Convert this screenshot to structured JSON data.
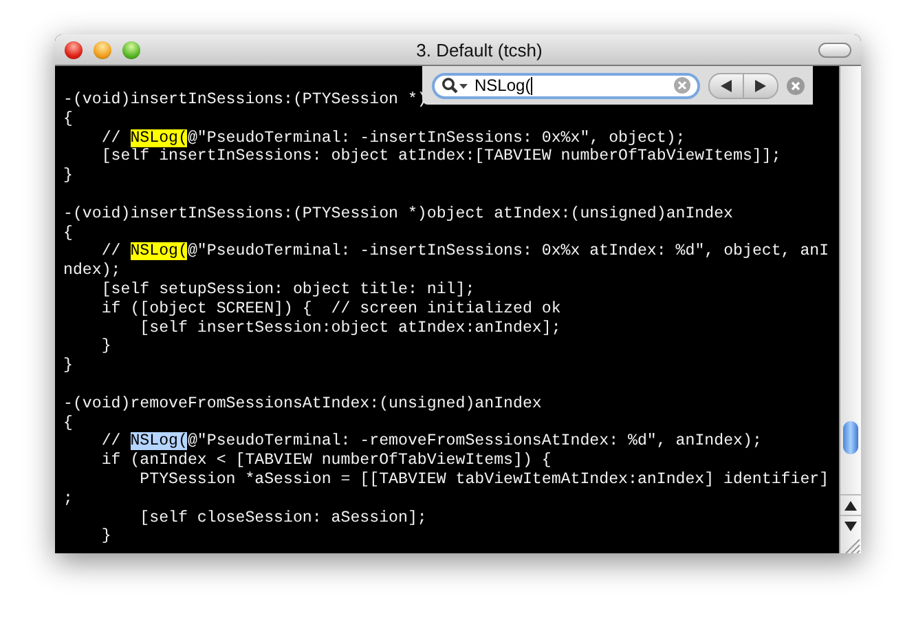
{
  "window": {
    "title": "3. Default (tcsh)"
  },
  "find_bar": {
    "query": "NSLog("
  },
  "terminal": {
    "lines": [
      {
        "kind": "code",
        "segments": [
          {
            "text": "-(void)insertInSessions:(PTYSession *)"
          }
        ]
      },
      {
        "kind": "code",
        "segments": [
          {
            "text": "{"
          }
        ]
      },
      {
        "kind": "code",
        "segments": [
          {
            "text": "    // "
          },
          {
            "text": "NSLog(",
            "match": true,
            "selected": false
          },
          {
            "text": "@\"PseudoTerminal: -insertInSessions: 0x%x\", object);"
          }
        ]
      },
      {
        "kind": "code",
        "segments": [
          {
            "text": "    [self insertInSessions: object atIndex:[TABVIEW numberOfTabViewItems]];"
          }
        ]
      },
      {
        "kind": "code",
        "segments": [
          {
            "text": "}"
          }
        ]
      },
      {
        "kind": "blank"
      },
      {
        "kind": "code",
        "segments": [
          {
            "text": "-(void)insertInSessions:(PTYSession *)object atIndex:(unsigned)anIndex"
          }
        ]
      },
      {
        "kind": "code",
        "segments": [
          {
            "text": "{"
          }
        ]
      },
      {
        "kind": "code",
        "segments": [
          {
            "text": "    // "
          },
          {
            "text": "NSLog(",
            "match": true,
            "selected": false
          },
          {
            "text": "@\"PseudoTerminal: -insertInSessions: 0x%x atIndex: %d\", object, anI"
          }
        ]
      },
      {
        "kind": "code",
        "segments": [
          {
            "text": "ndex);"
          }
        ]
      },
      {
        "kind": "code",
        "segments": [
          {
            "text": "    [self setupSession: object title: nil];"
          }
        ]
      },
      {
        "kind": "code",
        "segments": [
          {
            "text": "    if ([object SCREEN]) {  // screen initialized ok"
          }
        ]
      },
      {
        "kind": "code",
        "segments": [
          {
            "text": "        [self insertSession:object atIndex:anIndex];"
          }
        ]
      },
      {
        "kind": "code",
        "segments": [
          {
            "text": "    }"
          }
        ]
      },
      {
        "kind": "code",
        "segments": [
          {
            "text": "}"
          }
        ]
      },
      {
        "kind": "blank"
      },
      {
        "kind": "code",
        "segments": [
          {
            "text": "-(void)removeFromSessionsAtIndex:(unsigned)anIndex"
          }
        ]
      },
      {
        "kind": "code",
        "segments": [
          {
            "text": "{"
          }
        ]
      },
      {
        "kind": "code",
        "segments": [
          {
            "text": "    // "
          },
          {
            "text": "NSLog(",
            "match": true,
            "selected": true
          },
          {
            "text": "@\"PseudoTerminal: -removeFromSessionsAtIndex: %d\", anIndex);"
          }
        ]
      },
      {
        "kind": "code",
        "segments": [
          {
            "text": "    if (anIndex < [TABVIEW numberOfTabViewItems]) {"
          }
        ]
      },
      {
        "kind": "code",
        "segments": [
          {
            "text": "        PTYSession *aSession = [[TABVIEW tabViewItemAtIndex:anIndex] identifier]"
          }
        ]
      },
      {
        "kind": "code",
        "segments": [
          {
            "text": ";"
          }
        ]
      },
      {
        "kind": "code",
        "segments": [
          {
            "text": "        [self closeSession: aSession];"
          }
        ]
      },
      {
        "kind": "code",
        "segments": [
          {
            "text": "    }"
          }
        ]
      }
    ]
  }
}
